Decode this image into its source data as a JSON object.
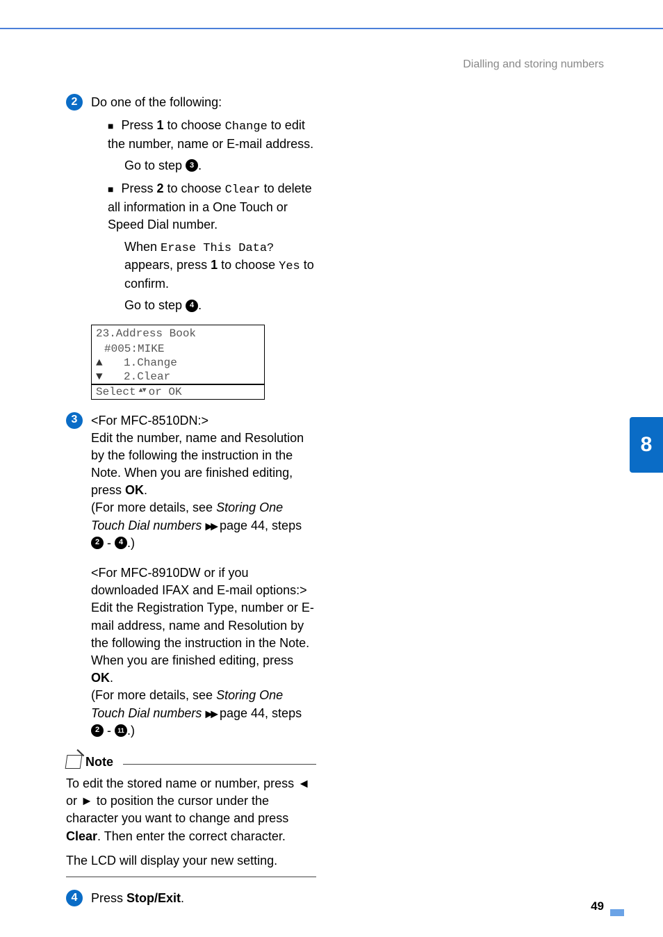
{
  "header": {
    "section": "Dialling and storing numbers"
  },
  "sideTab": {
    "number": "8"
  },
  "pageNumber": "49",
  "step2": {
    "intro": "Do one of the following:",
    "bullet1": {
      "textA": "Press ",
      "key": "1",
      "textB": " to choose ",
      "code": "Change",
      "textC": " to edit the number, name or E-mail address.",
      "goTo": "Go to step ",
      "ref": "3",
      "period": "."
    },
    "bullet2": {
      "textA": "Press ",
      "key": "2",
      "textB": " to choose ",
      "code": "Clear",
      "textC": " to delete all information in a One Touch or Speed Dial number.",
      "whenA": "When ",
      "whenCode": "Erase This Data?",
      "whenB": " appears, press ",
      "whenKey": "1",
      "whenC": " to choose ",
      "whenCode2": "Yes",
      "whenD": " to confirm.",
      "goTo": "Go to step ",
      "ref": "4",
      "period": "."
    }
  },
  "lcd": {
    "line1": "23.Address Book",
    "line2": "#005:MIKE",
    "line3": "1.Change",
    "line4": "2.Clear",
    "line5a": "Select ",
    "line5b": " or OK"
  },
  "step3": {
    "heading": "<For MFC-8510DN:>",
    "para1a": "Edit the number, name and Resolution by the following the instruction in the Note. When you are finished editing, press ",
    "ok1": "OK",
    "para1b": ".",
    "detailsA": "(For more details, see ",
    "detailsItalic": "Storing One Touch Dial numbers",
    "detailsB": " page 44, steps ",
    "refA": "2",
    "dash": " - ",
    "refB": "4",
    "detailsC": ".)",
    "heading2": "<For MFC-8910DW or if you downloaded IFAX and E-mail options:>",
    "para2a": "Edit the Registration Type, number or E-mail address, name and Resolution by the following the instruction in the Note. When you are finished editing, press ",
    "ok2": "OK",
    "para2b": ".",
    "details2A": "(For more details, see ",
    "details2Italic": "Storing One Touch Dial numbers",
    "details2B": " page 44, steps ",
    "ref2A": "2",
    "dash2": " - ",
    "ref2B": "11",
    "details2C": ".)"
  },
  "note": {
    "label": "Note",
    "p1a": "To edit the stored name or number, press ",
    "p1b": " or ",
    "p1c": " to position the cursor under the character you want to change and press ",
    "clear": "Clear",
    "p1d": ". Then enter the correct character.",
    "p2": "The LCD will display your new setting."
  },
  "step4": {
    "textA": "Press ",
    "key": "Stop/Exit",
    "textB": "."
  }
}
